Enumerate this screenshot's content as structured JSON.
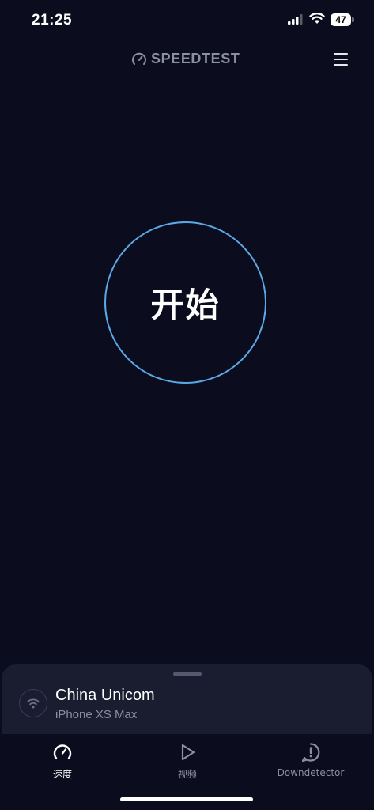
{
  "status_bar": {
    "time": "21:25",
    "battery_level": "47",
    "signal_bars_active": 3,
    "icons": [
      "signal-icon",
      "wifi-icon",
      "battery-icon"
    ]
  },
  "header": {
    "brand": "SPEEDTEST",
    "brand_icon": "speedometer-icon",
    "menu_icon": "hamburger-menu-icon"
  },
  "main": {
    "go_label": "开始"
  },
  "connection": {
    "provider": "China Unicom",
    "device": "iPhone XS Max",
    "icon": "wifi-icon"
  },
  "tabs": [
    {
      "label": "速度",
      "icon": "speedometer-icon",
      "active": true
    },
    {
      "label": "视频",
      "icon": "play-icon",
      "active": false
    },
    {
      "label": "Downdetector",
      "icon": "alert-icon",
      "active": false
    }
  ],
  "colors": {
    "background": "#0b0c1e",
    "ring": "#5aa9e6",
    "sheet": "#1a1c30",
    "muted_text": "#8c8f9f"
  }
}
